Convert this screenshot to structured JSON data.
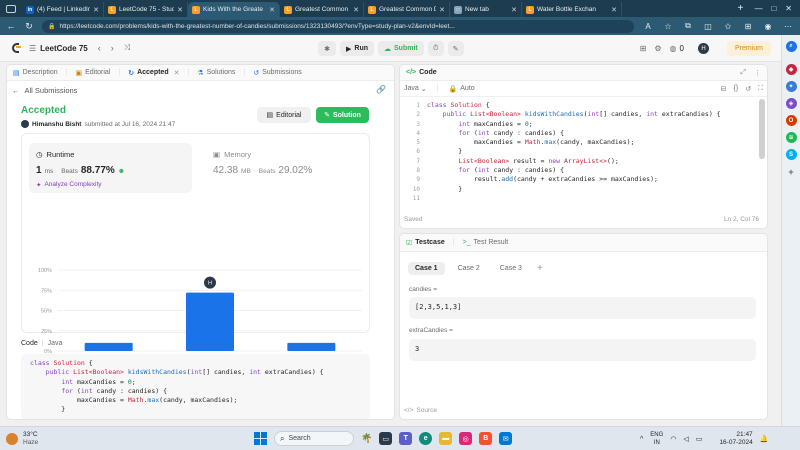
{
  "browser": {
    "tabs": [
      {
        "title": "(4) Feed | LinkedIn",
        "color": "#0a66c2",
        "glyph": "in"
      },
      {
        "title": "LeetCode 75 - Study",
        "color": "#ffa116",
        "glyph": "L"
      },
      {
        "title": "Kids With the Greate",
        "color": "#ffa116",
        "glyph": "L",
        "active": true
      },
      {
        "title": "Greatest Common D",
        "color": "#ffa116",
        "glyph": "L"
      },
      {
        "title": "Greatest Common D",
        "color": "#ffa116",
        "glyph": "L"
      },
      {
        "title": "New tab",
        "color": "#8aa4b4",
        "glyph": "□"
      },
      {
        "title": "Water Bottle Exchan",
        "color": "#ffa116",
        "glyph": "L"
      }
    ],
    "url": "https://leetcode.com/problems/kids-with-the-greatest-number-of-candies/submissions/1323130493/?envType=study-plan-v2&envId=leet..."
  },
  "topbar": {
    "title": "LeetCode 75",
    "run_label": "Run",
    "submit_label": "Submit",
    "streak": "0",
    "avatar": "H",
    "premium_label": "Premium"
  },
  "left": {
    "tabs": [
      "Description",
      "Editorial",
      "Accepted",
      "Solutions",
      "Submissions"
    ],
    "all_submissions": "All Submissions",
    "status": "Accepted",
    "user": "Himanshu Bisht",
    "submitted_at": "submitted at Jul 16, 2024 21:47",
    "editorial_btn": "Editorial",
    "solution_btn": "Solution",
    "runtime_label": "Runtime",
    "runtime_value": "1",
    "runtime_unit": "ms",
    "runtime_beats_label": "Beats",
    "runtime_beats": "88.77%",
    "analyze": "Analyze Complexity",
    "memory_label": "Memory",
    "memory_value": "42.38",
    "memory_unit": "MB",
    "memory_beats_label": "Beats",
    "memory_beats": "29.02%",
    "marker_avatar": "H",
    "code_label": "Code",
    "code_lang": "Java"
  },
  "chart_data": {
    "type": "bar",
    "categories": [
      "",
      "1ms",
      "2ms"
    ],
    "values": [
      10,
      72,
      10
    ],
    "highlight_index": 1,
    "title": "",
    "xlabel": "",
    "ylabel": "",
    "ylim": [
      0,
      100
    ],
    "yticks": [
      "100%",
      "75%",
      "50%",
      "25%",
      "0%"
    ],
    "grid": true,
    "bar_color": "#1a73e8",
    "mini_labels": [
      "1ms",
      "2ms"
    ]
  },
  "right": {
    "code_title": "Code",
    "lang": "Java",
    "mode": "Auto",
    "saved": "Saved",
    "cursor": "Ln 2, Col 76",
    "line_numbers": [
      "1",
      "2",
      "3",
      "4",
      "5",
      "6",
      "7",
      "8",
      "9",
      "10",
      "11"
    ],
    "testcase_tab": "Testcase",
    "result_tab": "Test Result",
    "cases": [
      "Case 1",
      "Case 2",
      "Case 3"
    ],
    "candies_label": "candies =",
    "candies_value": "[2,3,5,1,3]",
    "extra_label": "extraCandies =",
    "extra_value": "3",
    "source_label": "Source"
  },
  "taskbar": {
    "temp": "33°C",
    "weather": "Haze",
    "search_placeholder": "Search",
    "lang1": "ENG",
    "lang2": "IN",
    "time": "21:47",
    "date": "16-07-2024"
  }
}
